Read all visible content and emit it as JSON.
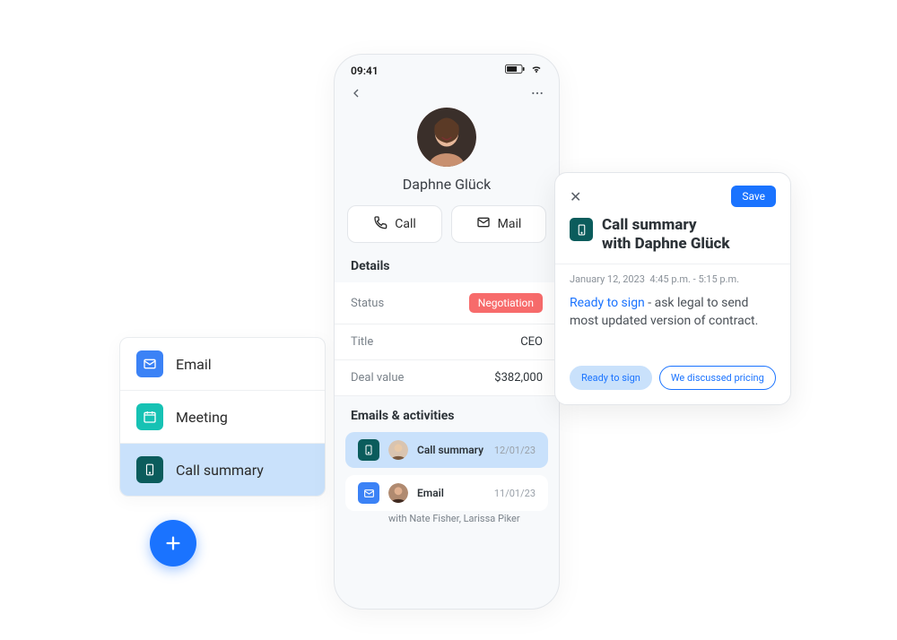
{
  "sidebar": {
    "items": [
      {
        "label": "Email",
        "icon": "mail-icon",
        "selected": false,
        "bg": "bg-blue"
      },
      {
        "label": "Meeting",
        "icon": "calendar-icon",
        "selected": false,
        "bg": "bg-teal"
      },
      {
        "label": "Call summary",
        "icon": "phone-device-icon",
        "selected": true,
        "bg": "bg-dteal"
      }
    ]
  },
  "fab_label": "+",
  "phone": {
    "time": "09:41",
    "contact_name": "Daphne Glück",
    "actions": {
      "call": "Call",
      "mail": "Mail"
    },
    "details_title": "Details",
    "details": {
      "status_label": "Status",
      "status_value": "Negotiation",
      "title_label": "Title",
      "title_value": "CEO",
      "deal_label": "Deal value",
      "deal_value": "$382,000"
    },
    "activities_title": "Emails & activities",
    "activities": [
      {
        "title": "Call summary",
        "date": "12/01/23",
        "icon": "phone-device-icon",
        "bg": "bg-dteal",
        "selected": true
      },
      {
        "title": "Email",
        "date": "11/01/23",
        "icon": "mail-icon",
        "bg": "bg-blue",
        "selected": false
      }
    ],
    "activity_sub": "with Nate Fisher, Larissa Piker"
  },
  "popup": {
    "save": "Save",
    "title_line1": "Call summary",
    "title_line2": "with Daphne Glück",
    "date": "January 12, 2023",
    "time": "4:45 p.m. - 5:15 p.m.",
    "body_link": "Ready to sign",
    "body_rest": " - ask legal to send most updated version of contract.",
    "chip1": "Ready to sign",
    "chip2": "We discussed pricing"
  }
}
